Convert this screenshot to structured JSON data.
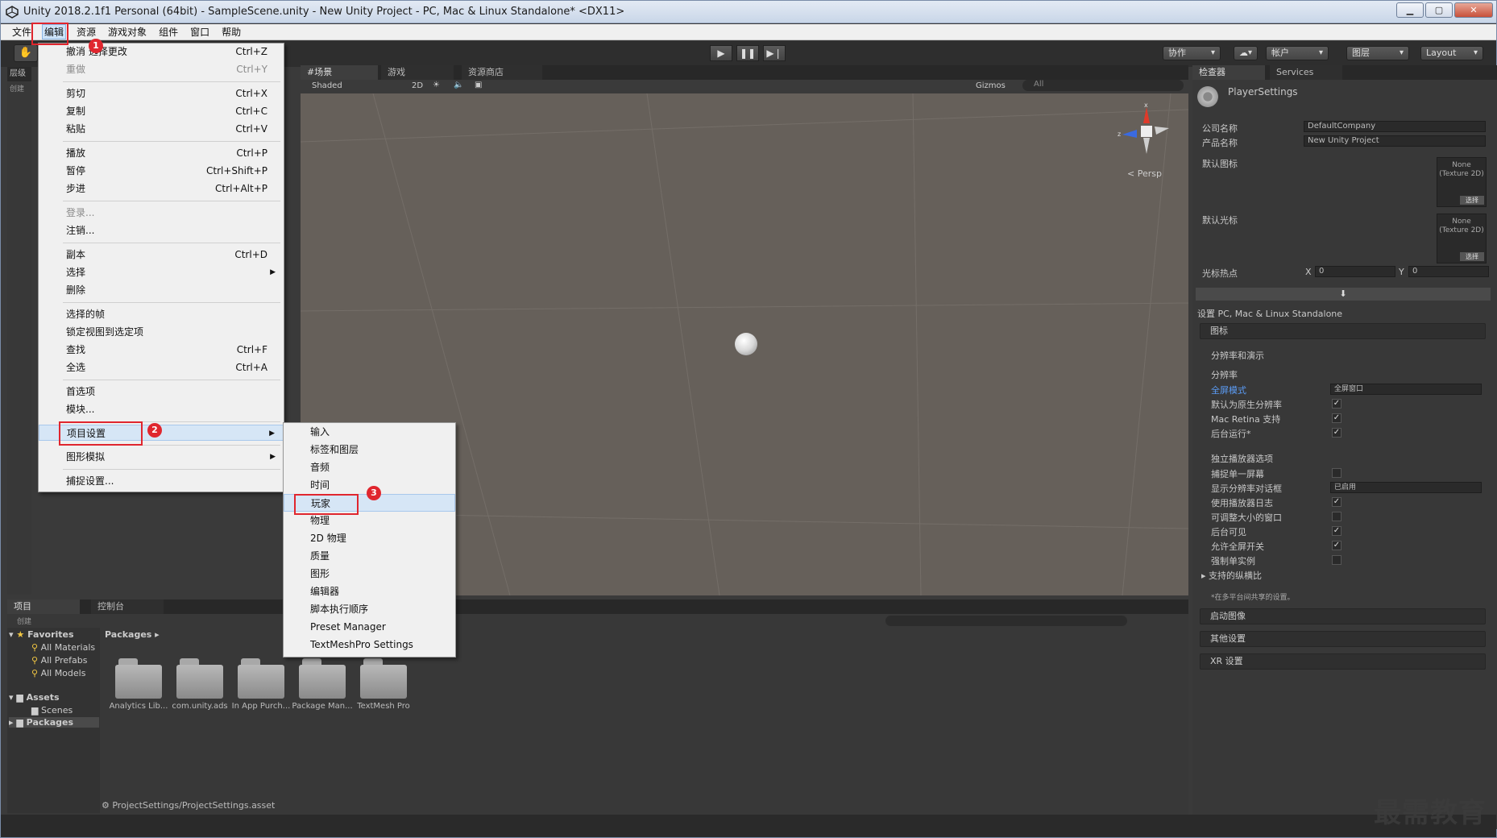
{
  "window": {
    "title": "Unity 2018.2.1f1 Personal (64bit) - SampleScene.unity - New Unity Project - PC, Mac & Linux Standalone* <DX11>"
  },
  "menubar": {
    "items": [
      "文件",
      "编辑",
      "资源",
      "游戏对象",
      "组件",
      "窗口",
      "帮助"
    ]
  },
  "toolbar": {
    "collab": "协作",
    "account": "帐户",
    "layers": "图层",
    "layout": "Layout"
  },
  "edit_menu": {
    "undo": {
      "label": "撤消 选择更改",
      "shortcut": "Ctrl+Z"
    },
    "redo": {
      "label": "重做",
      "shortcut": "Ctrl+Y"
    },
    "cut": {
      "label": "剪切",
      "shortcut": "Ctrl+X"
    },
    "copy": {
      "label": "复制",
      "shortcut": "Ctrl+C"
    },
    "paste": {
      "label": "粘贴",
      "shortcut": "Ctrl+V"
    },
    "play": {
      "label": "播放",
      "shortcut": "Ctrl+P"
    },
    "pause": {
      "label": "暂停",
      "shortcut": "Ctrl+Shift+P"
    },
    "step": {
      "label": "步进",
      "shortcut": "Ctrl+Alt+P"
    },
    "signin": {
      "label": "登录..."
    },
    "signout": {
      "label": "注销..."
    },
    "duplicate": {
      "label": "副本",
      "shortcut": "Ctrl+D"
    },
    "select": {
      "label": "选择"
    },
    "delete": {
      "label": "删除"
    },
    "frame_selected": {
      "label": "选择的帧"
    },
    "lock_view": {
      "label": "锁定视图到选定项"
    },
    "find": {
      "label": "查找",
      "shortcut": "Ctrl+F"
    },
    "select_all": {
      "label": "全选",
      "shortcut": "Ctrl+A"
    },
    "preferences": {
      "label": "首选项"
    },
    "modules": {
      "label": "模块..."
    },
    "project_settings": {
      "label": "项目设置"
    },
    "graphics_emulation": {
      "label": "图形模拟"
    },
    "snap_settings": {
      "label": "捕捉设置..."
    }
  },
  "project_settings_submenu": [
    "输入",
    "标签和图层",
    "音频",
    "时间",
    "玩家",
    "物理",
    "2D 物理",
    "质量",
    "图形",
    "编辑器",
    "脚本执行顺序",
    "Preset Manager",
    "TextMeshPro Settings"
  ],
  "callouts": [
    "1",
    "2",
    "3"
  ],
  "scene": {
    "tabs": [
      "#场景",
      "游戏",
      "资源商店"
    ],
    "shading": "Shaded",
    "mode_2d": "2D",
    "gizmos": "Gizmos",
    "search_placeholder": "All",
    "persp_label": "< Persp",
    "axis_x": "x",
    "axis_z": "z"
  },
  "hierarchy": {
    "tab": "层级",
    "create": "创建"
  },
  "inspector": {
    "tabs": [
      "检查器",
      "Services"
    ],
    "object": "PlayerSettings",
    "company_label": "公司名称",
    "company_value": "DefaultCompany",
    "product_label": "产品名称",
    "product_value": "New Unity Project",
    "default_icon_label": "默认图标",
    "default_cursor_label": "默认光标",
    "texture_none": "None\n(Texture 2D)",
    "select_btn": "选择",
    "cursor_hotspot_label": "光标热点",
    "hotspot_x_label": "X",
    "hotspot_x": "0",
    "hotspot_y_label": "Y",
    "hotspot_y": "0",
    "platform_settings": "设置 PC, Mac & Linux Standalone",
    "icon_section": "图标",
    "resolution_section": "分辨率和演示",
    "resolution_sub": "分辨率",
    "fullscreen_mode_label": "全屏模式",
    "fullscreen_mode_value": "全屏窗口",
    "default_native_label": "默认为原生分辨率",
    "mac_retina_label": "Mac Retina 支持",
    "run_background_label": "后台运行*",
    "standalone_player_label": "独立播放器选项",
    "capture_single_label": "捕捉单一屏幕",
    "display_res_dialog_label": "显示分辨率对话框",
    "display_res_dialog_value": "已启用",
    "player_log_label": "使用播放器日志",
    "resizable_label": "可调整大小的窗口",
    "visible_bg_label": "后台可见",
    "allow_fullscreen_label": "允许全屏开关",
    "force_single_label": "强制单实例",
    "aspect_ratios_label": "支持的纵横比",
    "shared_note": "*在多平台间共享的设置。",
    "splash_section": "启动图像",
    "other_section": "其他设置",
    "xr_section": "XR 设置"
  },
  "project": {
    "tabs": [
      "项目",
      "控制台"
    ],
    "create": "创建",
    "favorites": "Favorites",
    "fav_items": [
      "All Materials",
      "All Prefabs",
      "All Models"
    ],
    "assets": "Assets",
    "scenes": "Scenes",
    "packages": "Packages",
    "breadcrumb": "Packages",
    "folders": [
      "Analytics Lib...",
      "com.unity.ads",
      "In App Purch...",
      "Package Man...",
      "TextMesh Pro"
    ],
    "path": "ProjectSettings/ProjectSettings.asset"
  },
  "watermark": "最需教育"
}
